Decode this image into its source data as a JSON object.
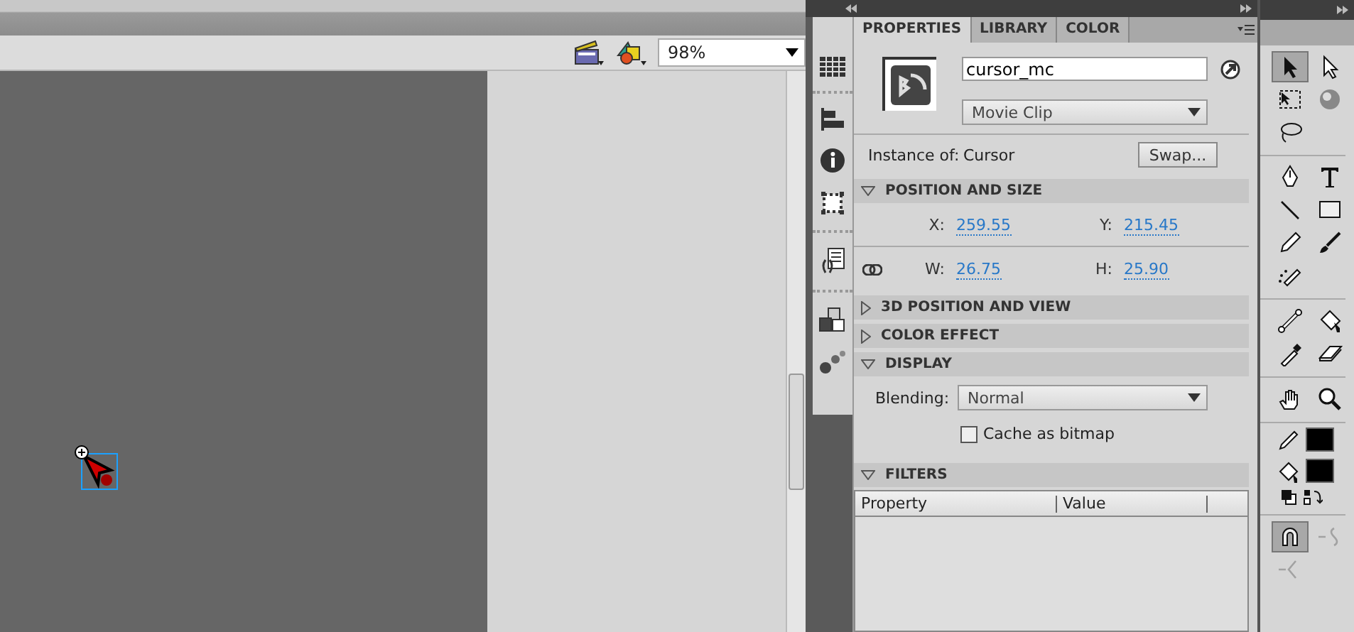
{
  "document_toolbar": {
    "zoom": "98%"
  },
  "properties_panel": {
    "tabs": [
      {
        "label": "PROPERTIES",
        "selected": true
      },
      {
        "label": "LIBRARY",
        "selected": false
      },
      {
        "label": "COLOR",
        "selected": false
      }
    ],
    "instance_name": "cursor_mc",
    "symbol_type": "Movie Clip",
    "instance_of_label": "Instance of:",
    "instance_of": "Cursor",
    "swap_button": "Swap...",
    "sections": [
      {
        "kind": "position",
        "title": "POSITION AND SIZE",
        "expanded": true,
        "fields": [
          {
            "label": "X:",
            "value": "259.55"
          },
          {
            "label": "Y:",
            "value": "215.45"
          },
          {
            "label": "W:",
            "value": "26.75"
          },
          {
            "label": "H:",
            "value": "25.90"
          }
        ]
      },
      {
        "title": "3D POSITION AND VIEW",
        "expanded": false
      },
      {
        "title": "COLOR EFFECT",
        "expanded": false
      },
      {
        "kind": "display",
        "title": "DISPLAY",
        "expanded": true,
        "blending_label": "Blending:",
        "blending": "Normal",
        "cache_label": "Cache as bitmap",
        "cache_checked": false
      },
      {
        "kind": "filters",
        "title": "FILTERS",
        "expanded": true,
        "columns": [
          "Property",
          "Value"
        ]
      }
    ]
  },
  "tools": {
    "groups": [
      [
        {
          "kind": "selection",
          "selected": true
        },
        {
          "kind": "subselection",
          "selected": false
        },
        {
          "kind": "free-transform",
          "selected": false
        },
        {
          "kind": "rotation",
          "selected": false
        },
        {
          "kind": "lasso",
          "selected": false
        }
      ],
      [
        {
          "kind": "pen",
          "selected": false
        },
        {
          "kind": "text",
          "selected": false
        },
        {
          "kind": "line",
          "selected": false
        },
        {
          "kind": "rectangle",
          "selected": false
        },
        {
          "kind": "pencil",
          "selected": false
        },
        {
          "kind": "brush",
          "selected": false
        },
        {
          "kind": "deco",
          "selected": false
        }
      ],
      [
        {
          "kind": "bone",
          "selected": false
        },
        {
          "kind": "bucket",
          "selected": false
        },
        {
          "kind": "eyedropper",
          "selected": false
        },
        {
          "kind": "eraser",
          "selected": false
        }
      ],
      [
        {
          "kind": "hand",
          "selected": false
        },
        {
          "kind": "zoom",
          "selected": false
        }
      ]
    ],
    "colors": [
      {
        "kind": "stroke",
        "color": "#000000"
      },
      {
        "kind": "fill",
        "color": "#000000"
      }
    ],
    "options": [
      {
        "kind": "snap",
        "selected": true,
        "disabled": false
      },
      {
        "kind": "smooth",
        "selected": false,
        "disabled": true
      },
      {
        "kind": "straighten",
        "selected": false,
        "disabled": true
      }
    ]
  }
}
